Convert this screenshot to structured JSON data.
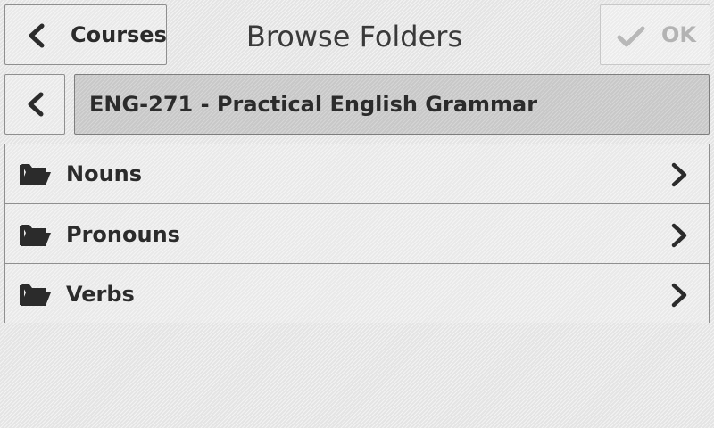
{
  "header": {
    "back_label": "Courses",
    "title": "Browse Folders",
    "ok_label": "OK"
  },
  "path": {
    "current_folder": "ENG-271 - Practical English Grammar"
  },
  "folders": [
    {
      "label": "Nouns",
      "icon": "folder-icon"
    },
    {
      "label": "Pronouns",
      "icon": "folder-icon"
    },
    {
      "label": "Verbs",
      "icon": "folder-icon"
    }
  ],
  "colors": {
    "text": "#2b2b2b",
    "disabled_text": "#b3b3b3",
    "path_bar": "#c8c8c8",
    "border": "#8f8f8f"
  }
}
